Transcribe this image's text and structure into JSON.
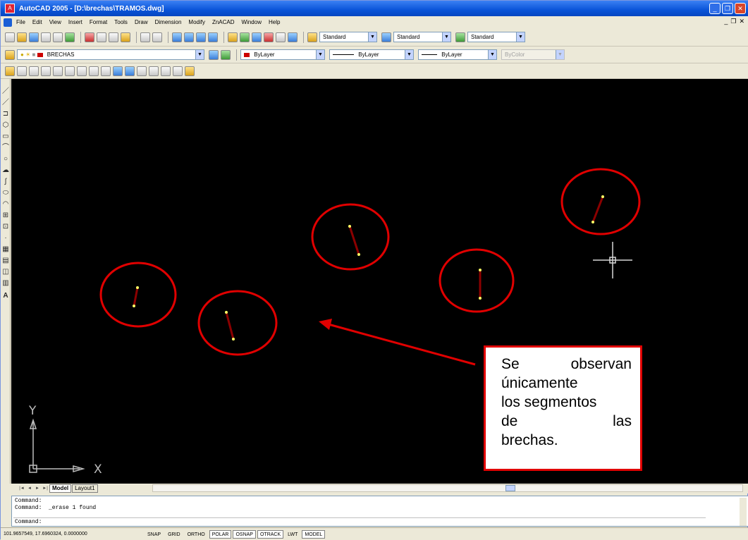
{
  "window": {
    "title": "AutoCAD 2005 - [D:\\brechas\\TRAMOS.dwg]",
    "buttons": [
      "_",
      "❐",
      "✕"
    ]
  },
  "menu": {
    "items": [
      "File",
      "Edit",
      "View",
      "Insert",
      "Format",
      "Tools",
      "Draw",
      "Dimension",
      "Modify",
      "ZnACAD",
      "Window",
      "Help"
    ]
  },
  "toolbars": {
    "text_style": "Standard",
    "dim_style": "Standard",
    "table_style": "Standard",
    "layer": "BRECHAS",
    "color": "ByLayer",
    "linetype": "ByLayer",
    "lineweight": "ByLayer",
    "plotstyle": "ByColor"
  },
  "drawing": {
    "ucs_y": "Y",
    "ucs_x": "X",
    "annotation_lines": [
      "Se observan",
      "únicamente",
      "los segmentos",
      "de las",
      "brechas."
    ],
    "highlight_color": "#e00000",
    "segment_color": "#8b0000",
    "grip_color": "#ffff66"
  },
  "tabs": {
    "nav": [
      "|◄",
      "◄",
      "►",
      "►|"
    ],
    "items": [
      "Model",
      "Layout1"
    ]
  },
  "command": {
    "lines": [
      "Command:",
      "Command:  _erase 1 found",
      "Command:"
    ]
  },
  "status": {
    "coordinates": "101.9657549, 17.6960324, 0.0000000",
    "buttons": [
      "SNAP",
      "GRID",
      "ORTHO",
      "POLAR",
      "OSNAP",
      "OTRACK",
      "LWT",
      "MODEL"
    ],
    "active": [
      "POLAR",
      "OSNAP",
      "OTRACK",
      "MODEL"
    ]
  }
}
